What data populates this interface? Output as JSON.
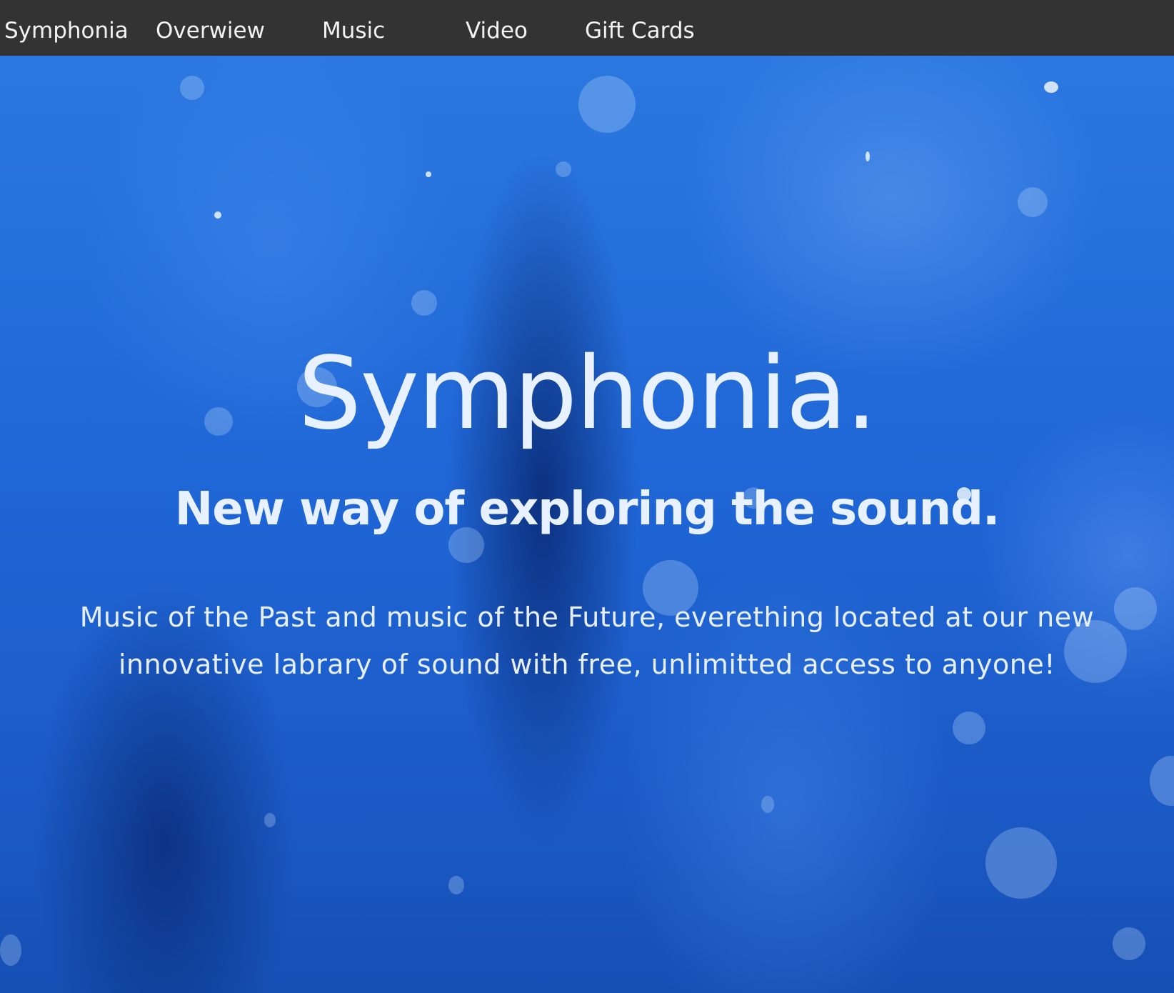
{
  "nav": {
    "brand": "Symphonia",
    "items": [
      {
        "label": "Overwiew"
      },
      {
        "label": "Music"
      },
      {
        "label": "Video"
      },
      {
        "label": "Gift Cards"
      }
    ]
  },
  "hero": {
    "title": "Symphonia.",
    "subtitle": "New way of exploring the sound.",
    "description": "Music of the Past and music of the Future, everething located at our new innovative labrary of sound with free, unlimitted access to anyone!"
  },
  "colors": {
    "nav_background": "#333333",
    "nav_text": "#f2f2f2",
    "hero_background": "#1f66d6",
    "hero_text": "#e8f1ff"
  }
}
